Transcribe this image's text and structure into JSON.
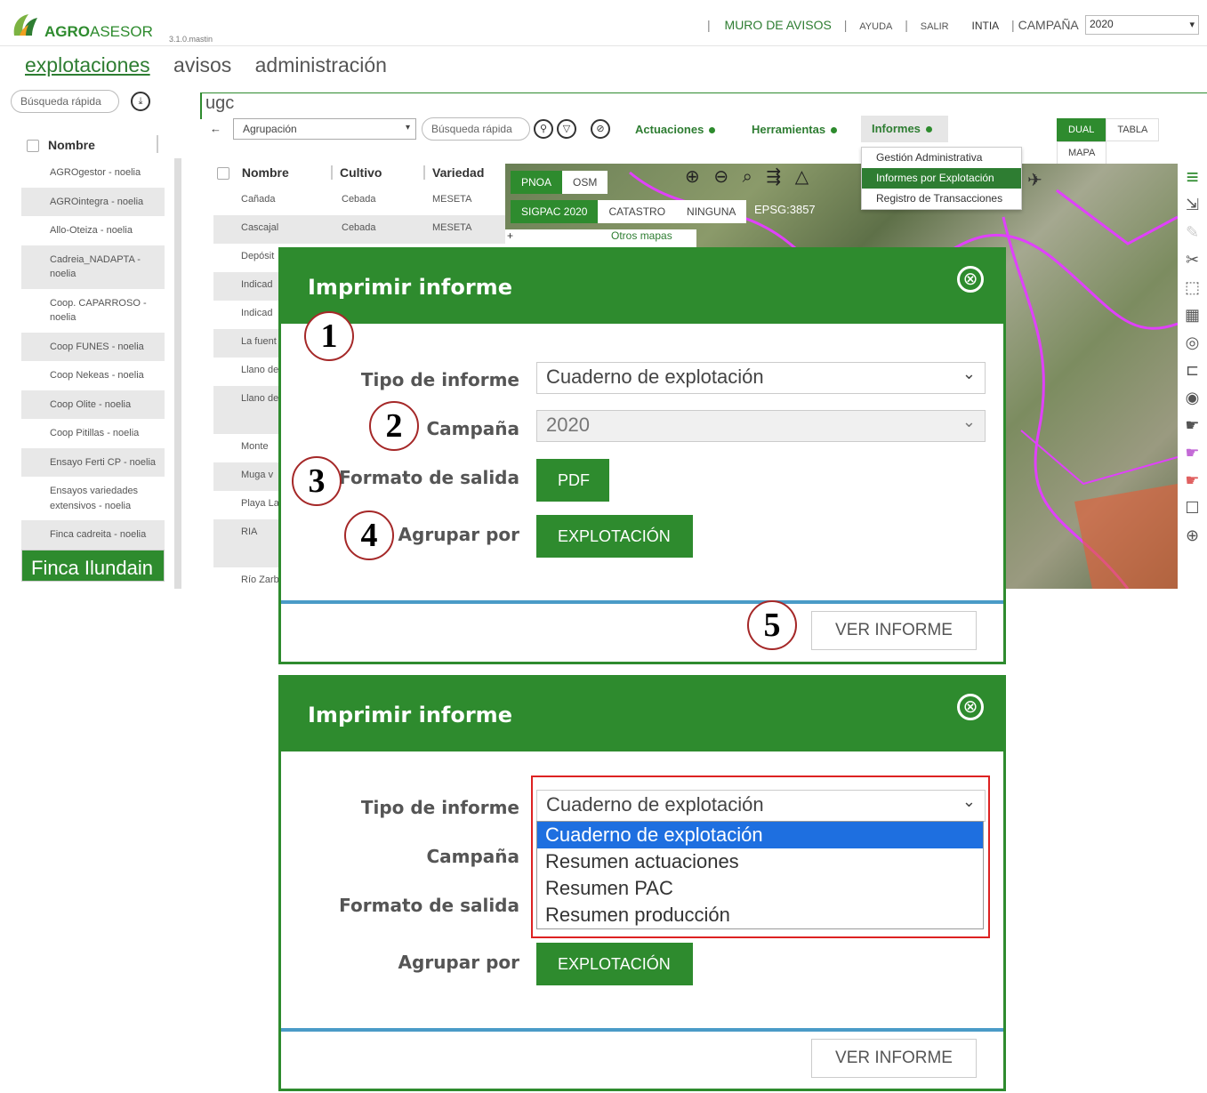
{
  "app": {
    "brand_bold": "AGRO",
    "brand_light": "ASESOR",
    "version": "3.1.0.mastin"
  },
  "toplinks": {
    "sep1": "|",
    "muro": "MURO DE AVISOS",
    "sep2": "|",
    "ayuda": "AYUDA",
    "sep3": "|",
    "salir": "SALIR",
    "user": "INTIA",
    "sep4": "|",
    "campana_label": "CAMPAÑA",
    "campana_value": "2020"
  },
  "nav": {
    "tabs": [
      "explotaciones",
      "avisos",
      "administración"
    ]
  },
  "left_search": {
    "placeholder": "Búsqueda rápida"
  },
  "search_term": "ugc",
  "list": {
    "header": "Nombre",
    "items": [
      "AGROgestor - noelia",
      "AGROintegra - noelia",
      "Allo-Oteiza - noelia",
      "Cadreia_NADAPTA - noelia",
      "Coop. CAPARROSO - noelia",
      "Coop FUNES - noelia",
      "Coop Nekeas - noelia",
      "Coop Olite - noelia",
      "Coop Pitillas - noelia",
      "Ensayo Ferti CP - noelia",
      "Ensayos variedades extensivos - noelia",
      "Finca cadreita - noelia",
      "Finca Ilundain - noelia"
    ]
  },
  "toolbar": {
    "back": "←",
    "agrupacion": "Agrupación",
    "search_placeholder": "Búsqueda rápida",
    "actuaciones": "Actuaciones",
    "herramientas": "Herramientas",
    "informes": "Informes",
    "views": [
      "DUAL",
      "TABLA",
      "MAPA"
    ]
  },
  "informes_menu": [
    "Gestión Administrativa",
    "Informes por Explotación",
    "Registro de Transacciones"
  ],
  "table": {
    "headers": [
      "Nombre",
      "Cultivo",
      "Variedad"
    ],
    "rows": [
      [
        "Cañada",
        "Cebada",
        "MESETA"
      ],
      [
        "Cascajal",
        "Cebada",
        "MESETA"
      ],
      [
        "Depósit",
        "",
        ""
      ],
      [
        "Indicad",
        "",
        ""
      ],
      [
        "Indicad",
        "",
        ""
      ],
      [
        "La fuent",
        "",
        ""
      ],
      [
        "Llano de",
        "",
        ""
      ],
      [
        "Llano de",
        "",
        ""
      ],
      [
        "Monte",
        "",
        ""
      ],
      [
        "Muga v",
        "",
        ""
      ],
      [
        "Playa La",
        "",
        ""
      ],
      [
        "RIA",
        "",
        ""
      ],
      [
        "Río Zarb",
        "",
        ""
      ]
    ]
  },
  "map": {
    "layers1": [
      "PNOA",
      "OSM"
    ],
    "layers2": [
      "SIGPAC 2020",
      "CATASTRO",
      "NINGUNA"
    ],
    "epsg": "EPSG:3857",
    "otros": "Otros mapas",
    "plus": "+"
  },
  "modal": {
    "title": "Imprimir informe",
    "close": "⊗",
    "tipo_label": "Tipo de informe",
    "tipo_value": "Cuaderno de explotación",
    "campana_label": "Campaña",
    "campana_value": "2020",
    "formato_label": "Formato de salida",
    "formato_value": "PDF",
    "agrupar_label": "Agrupar por",
    "agrupar_value": "EXPLOTACIÓN",
    "ver": "VER INFORME"
  },
  "dropdown_options": [
    "Cuaderno de explotación",
    "Resumen actuaciones",
    "Resumen PAC",
    "Resumen producción"
  ],
  "callouts": [
    "1",
    "2",
    "3",
    "4",
    "5"
  ],
  "colors": {
    "accent": "#2e8b2e",
    "highlight": "#1e6fe0",
    "annotation": "#d22222"
  }
}
